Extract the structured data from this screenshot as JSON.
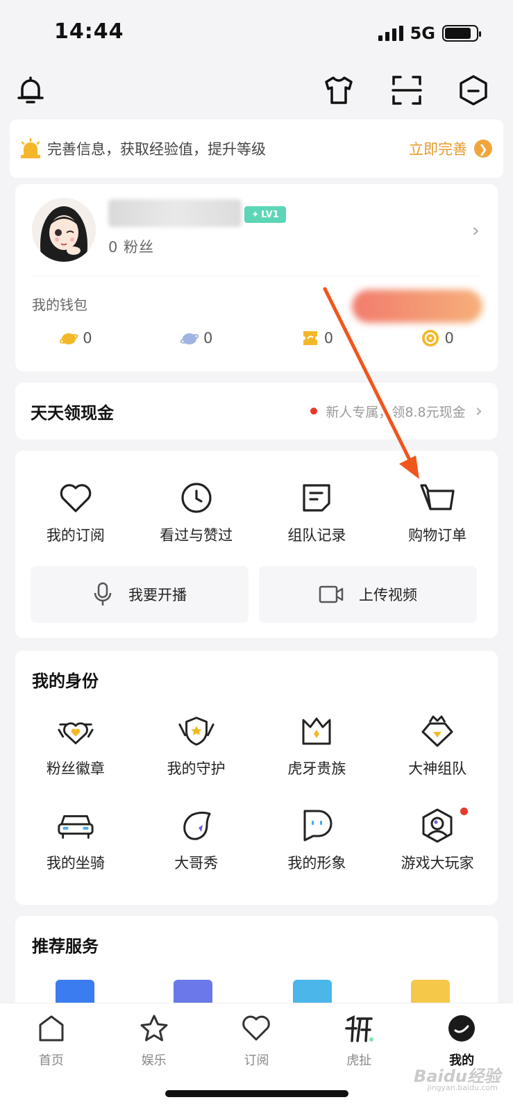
{
  "status_bar": {
    "time": "14:44",
    "network": "5G"
  },
  "top_bar": {
    "icons": [
      "bell-icon",
      "tshirt-icon",
      "scan-icon",
      "hexagon-minus-icon"
    ]
  },
  "banner": {
    "text": "完善信息，获取经验值，提升等级",
    "link_label": "立即完善",
    "icon": "alarm-bell-icon"
  },
  "profile": {
    "level": "LV1",
    "fans": "0 粉丝",
    "name_blurred": true
  },
  "wallet": {
    "label": "我的钱包",
    "items": [
      {
        "icon": "gold-bean-icon",
        "color": "#f2b829",
        "value": "0"
      },
      {
        "icon": "silver-bean-icon",
        "color": "#9fb4e0",
        "value": "0"
      },
      {
        "icon": "ticket-icon",
        "color": "#f2b829",
        "value": "0"
      },
      {
        "icon": "coin-icon",
        "color": "#f2b829",
        "value": "0"
      }
    ]
  },
  "daily_cash": {
    "title": "天天领现金",
    "subtitle": "新人专属，领8.8元现金"
  },
  "quick_actions": [
    {
      "label": "我的订阅",
      "icon": "heart-icon"
    },
    {
      "label": "看过与赞过",
      "icon": "clock-icon"
    },
    {
      "label": "组队记录",
      "icon": "note-icon"
    },
    {
      "label": "购物订单",
      "icon": "cart-icon"
    }
  ],
  "actions": {
    "live_label": "我要开播",
    "upload_label": "上传视频"
  },
  "identity": {
    "title": "我的身份",
    "items": [
      {
        "label": "粉丝徽章",
        "icon": "fan-badge-icon"
      },
      {
        "label": "我的守护",
        "icon": "guard-icon"
      },
      {
        "label": "虎牙贵族",
        "icon": "crown-icon"
      },
      {
        "label": "大神组队",
        "icon": "master-team-icon"
      },
      {
        "label": "我的坐骑",
        "icon": "car-icon"
      },
      {
        "label": "大哥秀",
        "icon": "big-brother-show-icon"
      },
      {
        "label": "我的形象",
        "icon": "avatar-image-icon"
      },
      {
        "label": "游戏大玩家",
        "icon": "game-player-icon"
      }
    ]
  },
  "recommend": {
    "title": "推荐服务"
  },
  "bottom_nav": [
    {
      "label": "首页",
      "icon": "home-icon"
    },
    {
      "label": "娱乐",
      "icon": "star-icon"
    },
    {
      "label": "订阅",
      "icon": "heart-icon"
    },
    {
      "label": "虎扯",
      "icon": "huche-icon"
    },
    {
      "label": "我的",
      "icon": "me-icon",
      "active": true
    }
  ],
  "colors": {
    "accent_orange": "#e79a2b",
    "badge_green": "#5cd6b6",
    "red_dot": "#e8392b",
    "annotation_arrow": "#f2551c"
  },
  "watermark": {
    "text": "Baidu经验",
    "sub": "jingyan.baidu.com"
  }
}
